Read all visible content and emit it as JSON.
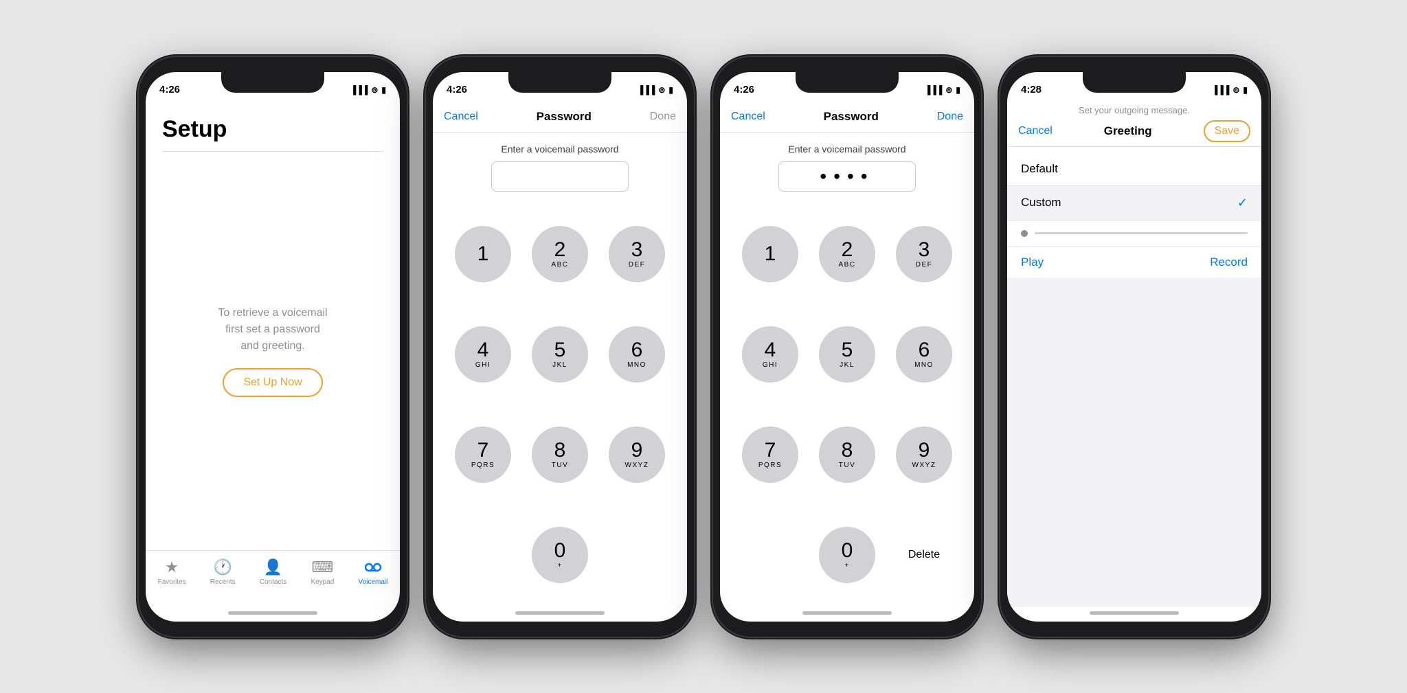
{
  "phones": [
    {
      "id": "phone1",
      "status_time": "4:26",
      "screen": "setup",
      "nav": {
        "title": ""
      },
      "setup": {
        "title": "Setup",
        "description": "To retrieve a voicemail\nfirst set a password\nand greeting.",
        "button_label": "Set Up Now"
      },
      "tabs": [
        {
          "icon": "★",
          "label": "Favorites",
          "active": false
        },
        {
          "icon": "🕐",
          "label": "Recents",
          "active": false
        },
        {
          "icon": "👤",
          "label": "Contacts",
          "active": false
        },
        {
          "icon": "⌨",
          "label": "Keypad",
          "active": false
        },
        {
          "icon": "🔊",
          "label": "Voicemail",
          "active": true
        }
      ]
    },
    {
      "id": "phone2",
      "status_time": "4:26",
      "screen": "password_empty",
      "nav": {
        "cancel": "Cancel",
        "title": "Password",
        "done": "Done",
        "done_active": false
      },
      "password": {
        "label": "Enter a voicemail password",
        "value": "",
        "dots": ""
      },
      "keypad": [
        {
          "num": "1",
          "letters": ""
        },
        {
          "num": "2",
          "letters": "ABC"
        },
        {
          "num": "3",
          "letters": "DEF"
        },
        {
          "num": "4",
          "letters": "GHI"
        },
        {
          "num": "5",
          "letters": "JKL"
        },
        {
          "num": "6",
          "letters": "MNO"
        },
        {
          "num": "7",
          "letters": "PQRS"
        },
        {
          "num": "8",
          "letters": "TUV"
        },
        {
          "num": "9",
          "letters": "WXYZ"
        },
        {
          "num": "0",
          "letters": "+"
        }
      ]
    },
    {
      "id": "phone3",
      "status_time": "4:26",
      "screen": "password_filled",
      "nav": {
        "cancel": "Cancel",
        "title": "Password",
        "done": "Done",
        "done_active": true
      },
      "password": {
        "label": "Enter a voicemail password",
        "value": "••••",
        "dots": "••••"
      },
      "keypad": [
        {
          "num": "1",
          "letters": ""
        },
        {
          "num": "2",
          "letters": "ABC"
        },
        {
          "num": "3",
          "letters": "DEF"
        },
        {
          "num": "4",
          "letters": "GHI"
        },
        {
          "num": "5",
          "letters": "JKL"
        },
        {
          "num": "6",
          "letters": "MNO"
        },
        {
          "num": "7",
          "letters": "PQRS"
        },
        {
          "num": "8",
          "letters": "TUV"
        },
        {
          "num": "9",
          "letters": "WXYZ"
        },
        {
          "num": "0",
          "letters": "+"
        }
      ],
      "delete_label": "Delete"
    },
    {
      "id": "phone4",
      "status_time": "4:28",
      "screen": "greeting",
      "nav": {
        "cancel": "Cancel",
        "title": "Greeting",
        "save": "Save"
      },
      "greeting": {
        "subtitle": "Set your outgoing message.",
        "options": [
          {
            "label": "Default",
            "selected": false
          },
          {
            "label": "Custom",
            "selected": true
          }
        ],
        "play_label": "Play",
        "record_label": "Record"
      }
    }
  ],
  "icons": {
    "signal": "▐▐▐",
    "wifi": "⊚",
    "battery": "▮"
  }
}
